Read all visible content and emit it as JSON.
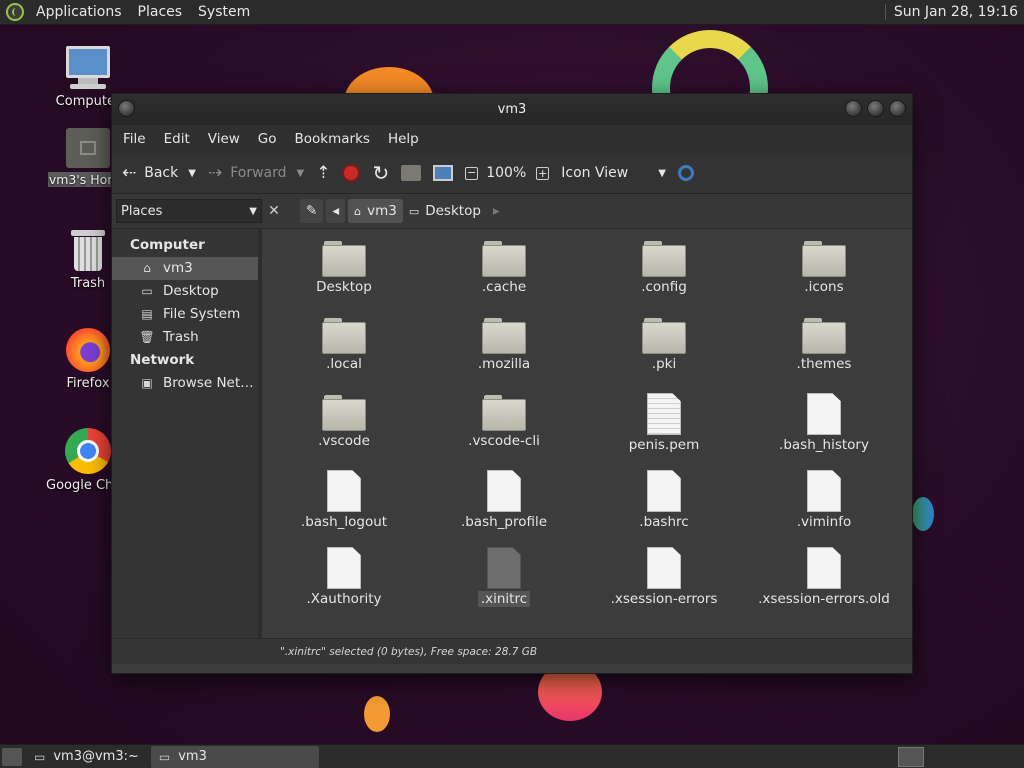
{
  "top_panel": {
    "menus": [
      "Applications",
      "Places",
      "System"
    ],
    "clock": "Sun Jan 28, 19:16"
  },
  "desktop": {
    "icons": [
      {
        "label": "Computer",
        "icon": "computer-icon"
      },
      {
        "label": "vm3's Home",
        "icon": "home-folder-icon"
      },
      {
        "label": "Trash",
        "icon": "trash-icon"
      },
      {
        "label": "Firefox",
        "icon": "firefox-icon"
      },
      {
        "label": "Google Chrome",
        "icon": "chrome-icon"
      }
    ]
  },
  "window": {
    "title": "vm3",
    "menubar": [
      "File",
      "Edit",
      "View",
      "Go",
      "Bookmarks",
      "Help"
    ],
    "toolbar": {
      "back": "Back",
      "forward": "Forward",
      "zoom": "100%",
      "view_mode": "Icon View"
    },
    "places_label": "Places",
    "breadcrumbs": [
      "vm3",
      "Desktop"
    ],
    "sidebar": {
      "sections": [
        {
          "heading": "Computer",
          "items": [
            {
              "label": "vm3",
              "icon": "home-icon",
              "selected": true
            },
            {
              "label": "Desktop",
              "icon": "desktop-folder-icon",
              "selected": false
            },
            {
              "label": "File System",
              "icon": "drive-icon",
              "selected": false
            },
            {
              "label": "Trash",
              "icon": "trash-icon",
              "selected": false
            }
          ]
        },
        {
          "heading": "Network",
          "items": [
            {
              "label": "Browse Net…",
              "icon": "network-icon",
              "selected": false
            }
          ]
        }
      ]
    },
    "files": [
      {
        "name": "Desktop",
        "type": "folder"
      },
      {
        "name": ".cache",
        "type": "folder"
      },
      {
        "name": ".config",
        "type": "folder"
      },
      {
        "name": ".icons",
        "type": "folder"
      },
      {
        "name": ".local",
        "type": "folder"
      },
      {
        "name": ".mozilla",
        "type": "folder"
      },
      {
        "name": ".pki",
        "type": "folder"
      },
      {
        "name": ".themes",
        "type": "folder"
      },
      {
        "name": ".vscode",
        "type": "folder"
      },
      {
        "name": ".vscode-cli",
        "type": "folder"
      },
      {
        "name": "penis.pem",
        "type": "text"
      },
      {
        "name": ".bash_history",
        "type": "file"
      },
      {
        "name": ".bash_logout",
        "type": "file"
      },
      {
        "name": ".bash_profile",
        "type": "file"
      },
      {
        "name": ".bashrc",
        "type": "file"
      },
      {
        "name": ".viminfo",
        "type": "file"
      },
      {
        "name": ".Xauthority",
        "type": "file"
      },
      {
        "name": ".xinitrc",
        "type": "file",
        "selected": true
      },
      {
        "name": ".xsession-errors",
        "type": "file"
      },
      {
        "name": ".xsession-errors.old",
        "type": "file"
      }
    ],
    "status": "\".xinitrc\" selected (0 bytes), Free space: 28.7 GB"
  },
  "taskbar": {
    "tasks": [
      {
        "label": "vm3@vm3:~",
        "icon": "terminal-icon",
        "active": false
      },
      {
        "label": "vm3",
        "icon": "folder-icon",
        "active": true
      }
    ]
  }
}
